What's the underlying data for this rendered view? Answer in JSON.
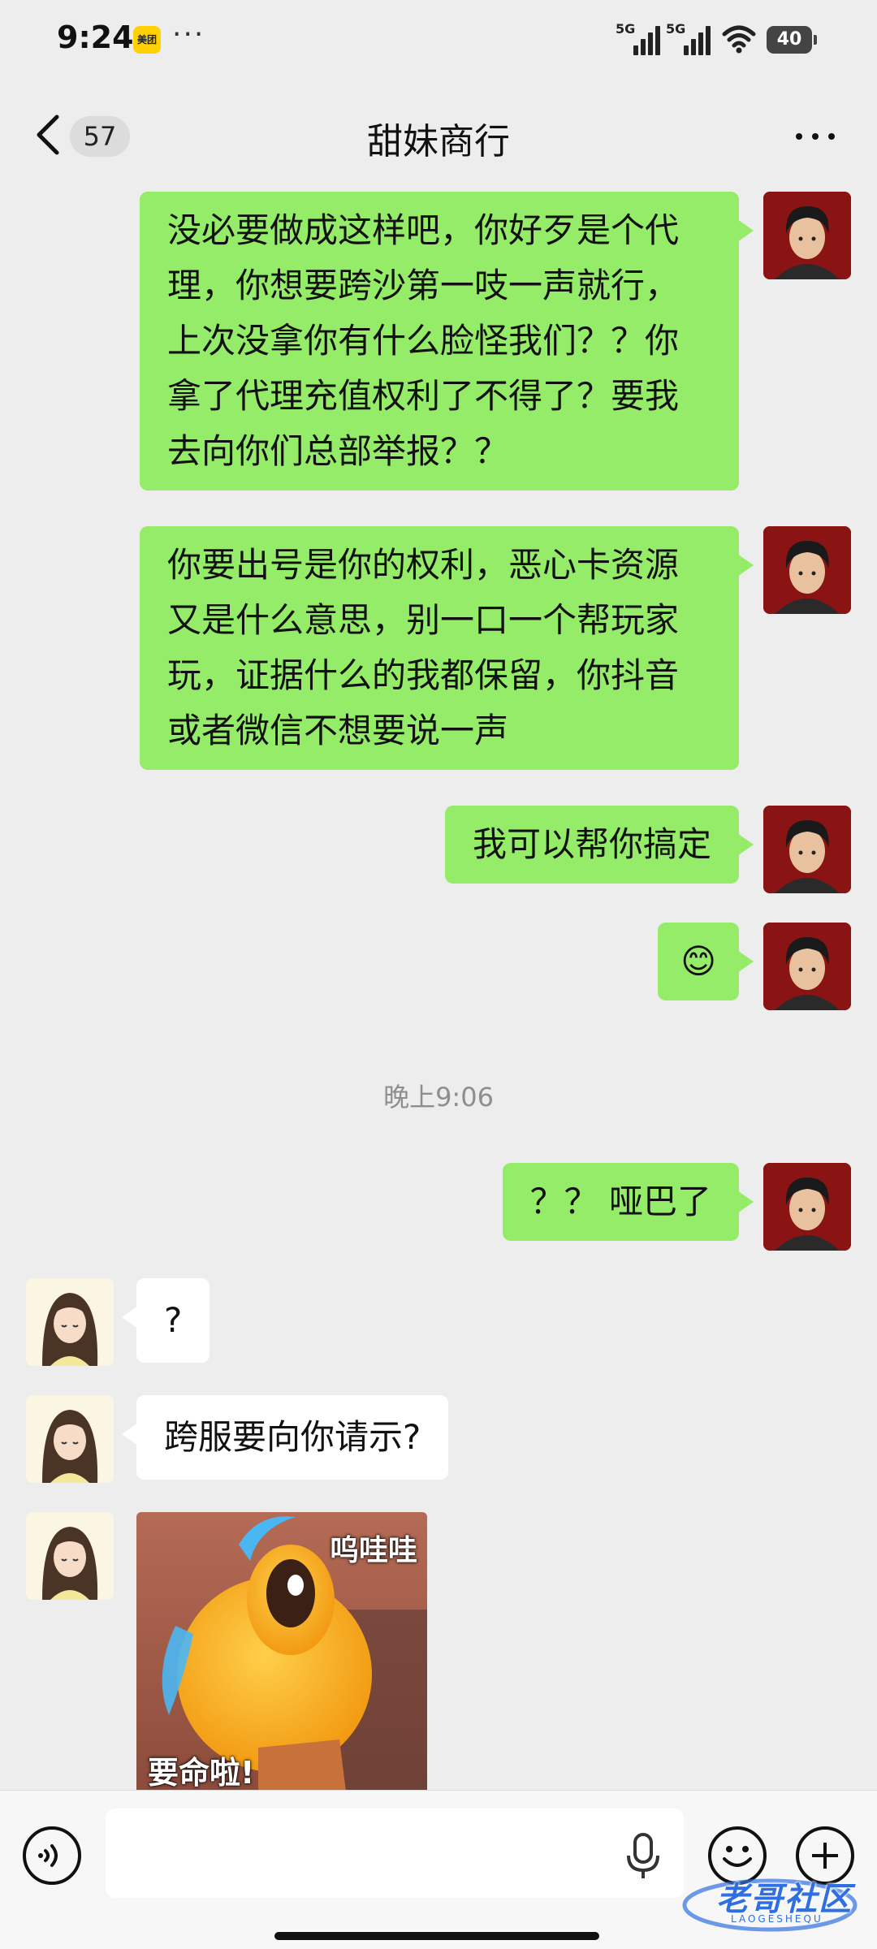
{
  "status_bar": {
    "time": "9:24",
    "app_badge": "美团",
    "more": "···",
    "signal_1": "5G",
    "signal_2": "5G",
    "battery": "40"
  },
  "header": {
    "unread_count": "57",
    "title": "甜妹商行"
  },
  "messages": [
    {
      "from": "self",
      "text": "没必要做成这样吧，你好歹是个代理，你想要跨沙第一吱一声就行，上次没拿你有什么脸怪我们？？你拿了代理充值权利了不得了？要我去向你们总部举报？？"
    },
    {
      "from": "self",
      "text": "你要出号是你的权利，恶心卡资源又是什么意思，别一口一个帮玩家玩，证据什么的我都保留，你抖音或者微信不想要说一声"
    },
    {
      "from": "self",
      "text": "我可以帮你搞定"
    },
    {
      "from": "self",
      "text": "😊"
    },
    {
      "from": "self",
      "text": "？？ 哑巴了"
    },
    {
      "from": "peer",
      "text": "?"
    },
    {
      "from": "peer",
      "text": "跨服要向你请示?"
    }
  ],
  "timestamp": "晚上9:06",
  "sticker": {
    "caption_top": "呜哇哇",
    "caption_bottom": "要命啦!"
  },
  "input": {
    "placeholder": ""
  },
  "watermark": {
    "text": "老哥社区",
    "sub": "LAOGESHEQU"
  }
}
